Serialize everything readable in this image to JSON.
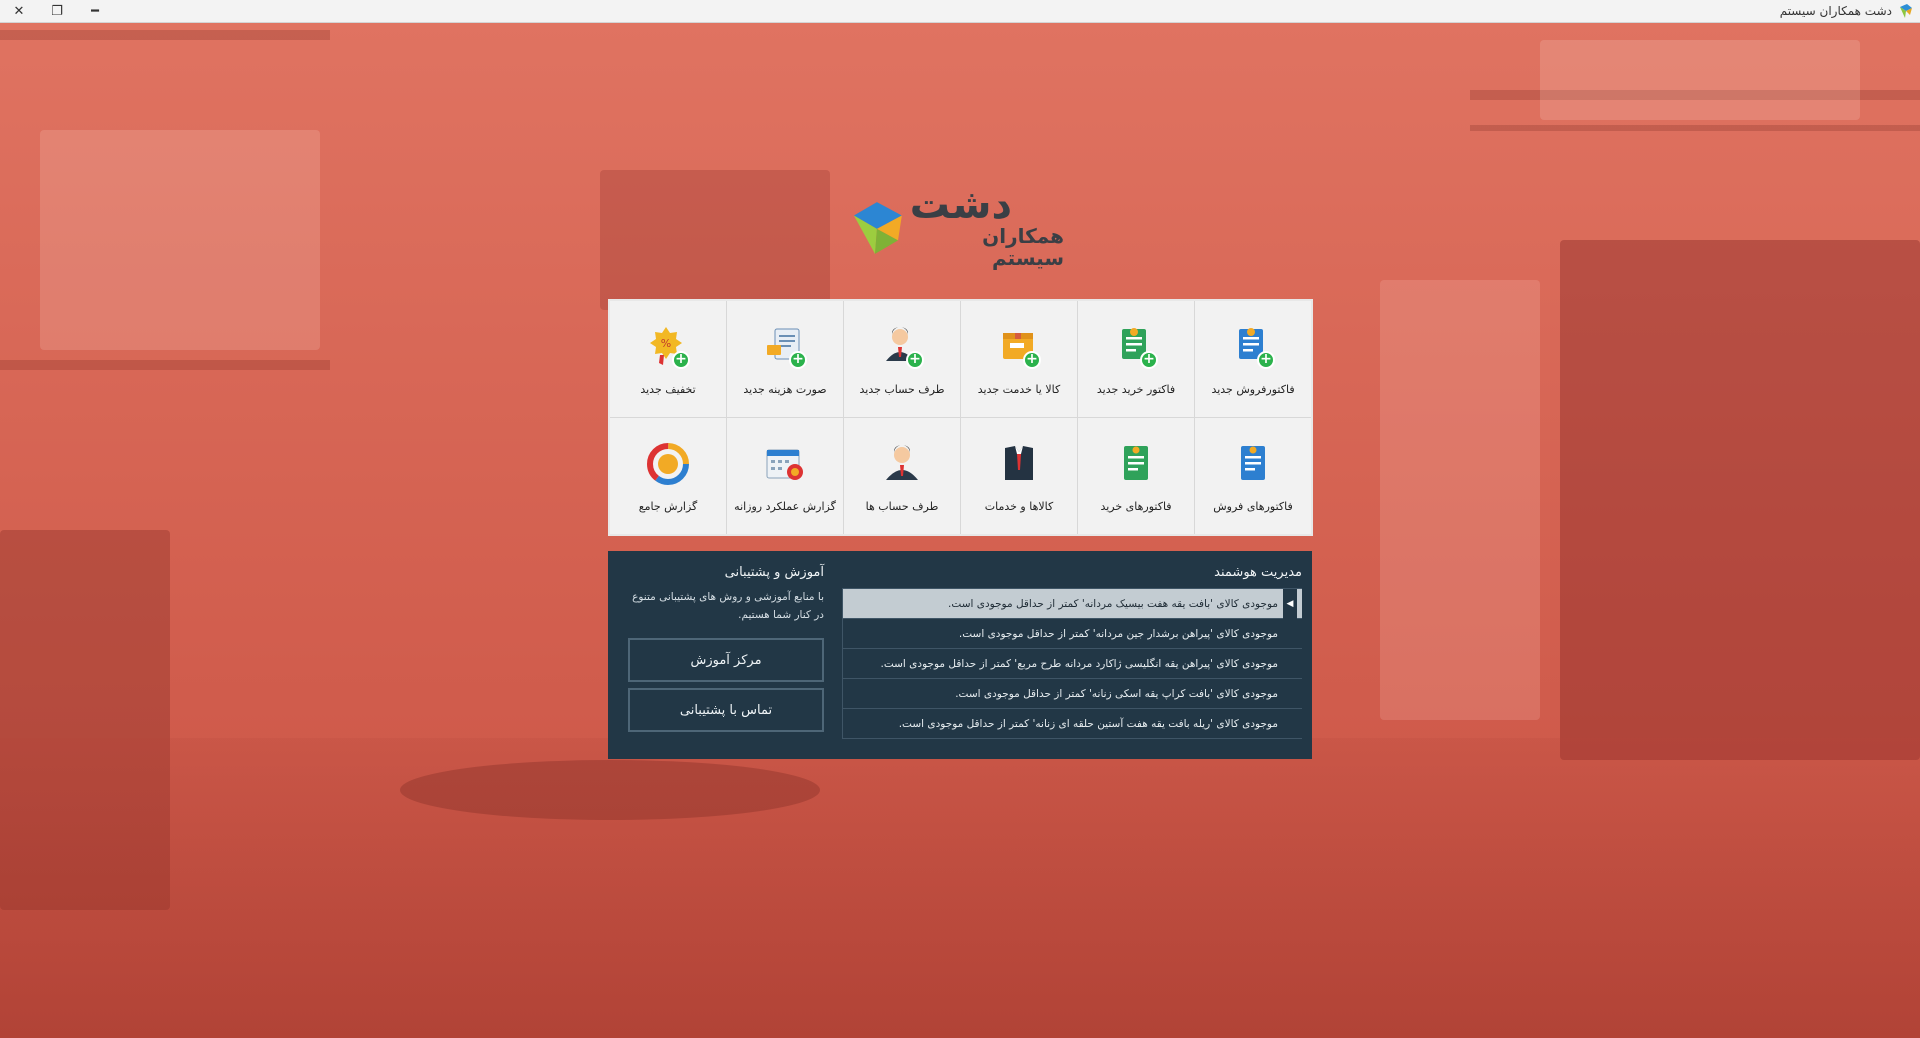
{
  "window": {
    "title": "دشت همکاران سیستم",
    "controls": {
      "close": "✕",
      "restore": "❐",
      "minimize": "━"
    }
  },
  "logo": {
    "main": "دشت",
    "sub": "همکاران سیستم"
  },
  "tiles": [
    {
      "label": "فاکتورفروش جدید",
      "icon": "new-sales-invoice-icon"
    },
    {
      "label": "فاکتور خرید جدید",
      "icon": "new-purchase-invoice-icon"
    },
    {
      "label": "کالا یا خدمت جدید",
      "icon": "new-product-icon"
    },
    {
      "label": "طرف حساب جدید",
      "icon": "new-account-party-icon"
    },
    {
      "label": "صورت هزینه جدید",
      "icon": "new-expense-icon"
    },
    {
      "label": "تخفیف جدید",
      "icon": "new-discount-icon"
    },
    {
      "label": "فاکتورهای فروش",
      "icon": "sales-invoices-icon"
    },
    {
      "label": "فاکتورهای خرید",
      "icon": "purchase-invoices-icon"
    },
    {
      "label": "کالاها و خدمات",
      "icon": "products-services-icon"
    },
    {
      "label": "طرف حساب ها",
      "icon": "account-parties-icon"
    },
    {
      "label": "گزارش عملکرد روزانه",
      "icon": "daily-report-icon"
    },
    {
      "label": "گزارش جامع",
      "icon": "comprehensive-report-icon"
    }
  ],
  "smart": {
    "title": "مدیریت هوشمند",
    "selected_marker": "◀",
    "alerts": [
      "موجودی کالای  'بافت یقه هفت بیسیک مردانه'  کمتر از حداقل موجودی است.",
      "موجودی کالای  'پیراهن برشدار جین مردانه'  کمتر از حداقل موجودی است.",
      "موجودی کالای  'پیراهن یقه انگلیسی ژاکارد مردانه طرح مربع'  کمتر از حداقل موجودی است.",
      "موجودی کالای  'بافت کراپ یقه اسکی زنانه'  کمتر از حداقل موجودی است.",
      "موجودی کالای  'ریله بافت یقه هفت آستین حلقه ای زنانه'  کمتر از حداقل موجودی است."
    ]
  },
  "support": {
    "title": "آموزش و  پشتیبانی",
    "description": "با منابع آموزشی و روش های پشتیبانی متنوع در کنار شما هستیم.",
    "training_button": "مرکز آموزش",
    "contact_button": "تماس با پشتیبانی"
  },
  "colors": {
    "panel_bg": "#223746",
    "tile_bg": "#f2f2f2",
    "background_tint": "#d8604e",
    "accent_green": "#2bb24c",
    "accent_blue": "#2d7fd0"
  }
}
